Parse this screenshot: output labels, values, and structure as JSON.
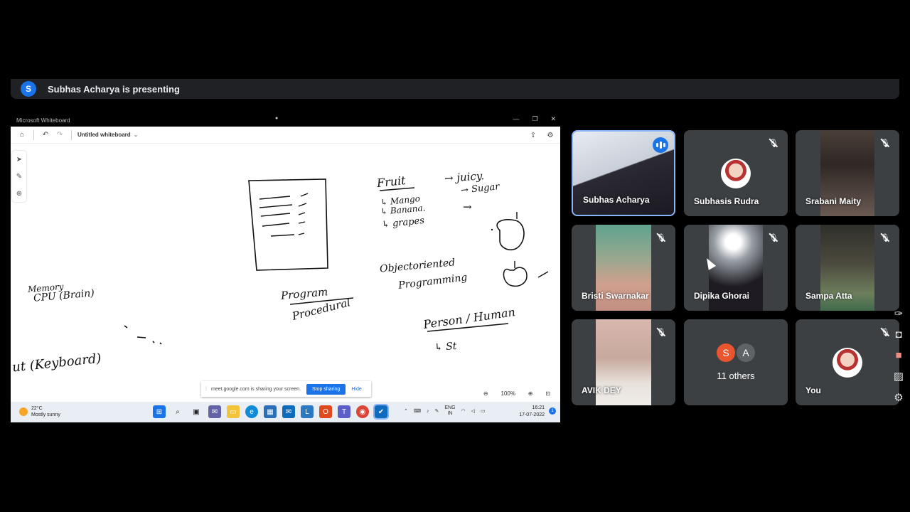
{
  "presenting": {
    "initial": "S",
    "text": "Subhas Acharya is presenting"
  },
  "whiteboard": {
    "app_title": "Microsoft Whiteboard",
    "doc_title": "Untitled whiteboard",
    "zoom": "100%",
    "share_notice": "meet.google.com is sharing your screen.",
    "stop_sharing": "Stop sharing",
    "hide": "Hide",
    "ink": {
      "fruit": "Fruit",
      "juicy": "→ juicy.",
      "mango": "↳ Mango",
      "banana": "↳ Banana.",
      "sugar": "→ Sugar",
      "grapes": "↳ grapes",
      "arrow3": "→",
      "oop1": "Objectoriented",
      "oop2": "Programming",
      "program": "Program",
      "procedural": "Procedural",
      "person": "Person / Human",
      "st": "↳ St",
      "memory": "Memory",
      "cpu": "CPU (Brain)",
      "keyboard": "ut (Keyboard)"
    }
  },
  "taskbar": {
    "temp": "22°C",
    "weather": "Mostly sunny",
    "lang1": "ENG",
    "lang2": "IN",
    "time": "16:21",
    "date": "17-07-2022",
    "notif": "1"
  },
  "participants": [
    {
      "name": "Subhas Acharya",
      "state": "speaking"
    },
    {
      "name": "Subhasis Rudra",
      "state": "muted"
    },
    {
      "name": "Srabani Maity",
      "state": "muted"
    },
    {
      "name": "Bristi Swarnakar",
      "state": "muted"
    },
    {
      "name": "Dipika Ghorai",
      "state": "muted"
    },
    {
      "name": "Sampa Atta",
      "state": "muted"
    },
    {
      "name": "AVIK DEY",
      "state": "muted"
    },
    {
      "name": "11 others",
      "initials": [
        "S",
        "A"
      ]
    },
    {
      "name": "You",
      "state": "muted"
    }
  ],
  "colors": {
    "accent": "#1a73e8",
    "tile_bg": "#3c4043",
    "bar_bg": "#202124"
  }
}
